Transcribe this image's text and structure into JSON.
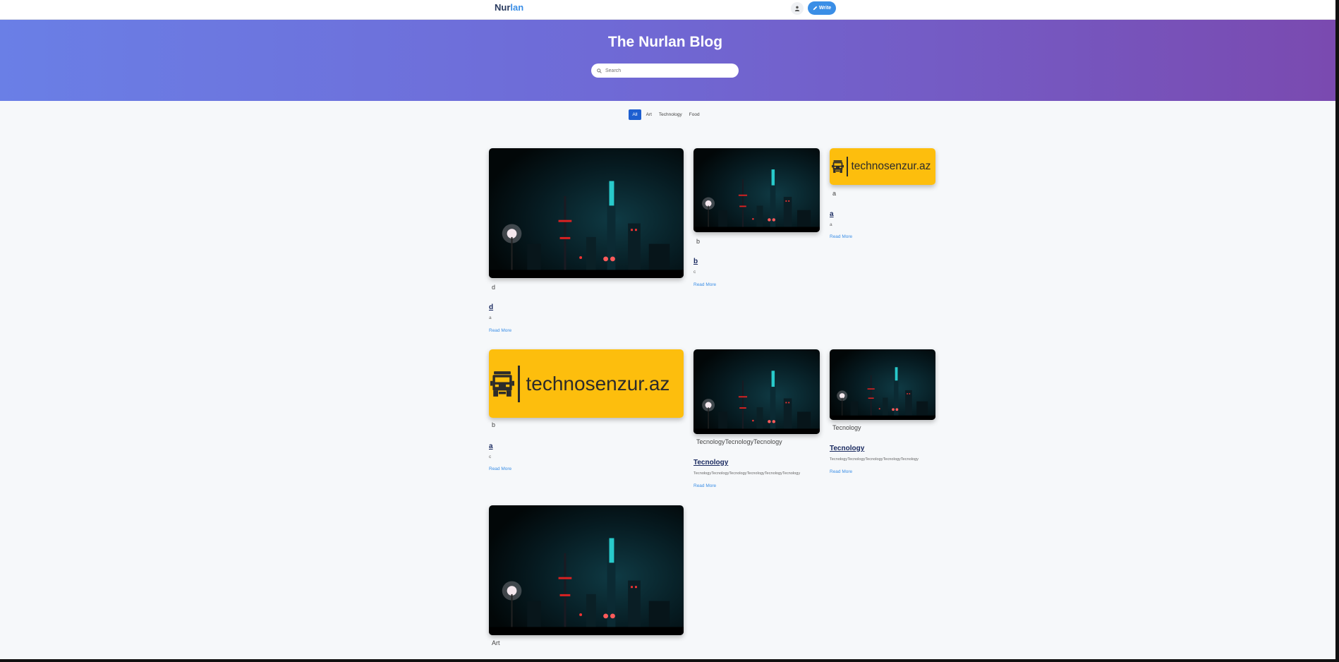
{
  "nav": {
    "brand_part1": "Nur",
    "brand_part2": "lan",
    "write_label": "Write"
  },
  "hero": {
    "title": "The Nurlan Blog",
    "search_placeholder": "Search"
  },
  "categories": [
    "All",
    "Art",
    "Technology",
    "Food"
  ],
  "logo_text": "technosenzur.az",
  "read_more": "Read More",
  "posts": [
    {
      "image": "city",
      "tag": "d",
      "title": "d",
      "excerpt": "a"
    },
    {
      "image": "city",
      "tag": "b",
      "title": "b",
      "excerpt": "c"
    },
    {
      "image": "logo",
      "tag": "a",
      "title": "a",
      "excerpt": "a"
    },
    {
      "image": "logo",
      "tag": "b",
      "title": "a",
      "excerpt": "c"
    },
    {
      "image": "city",
      "tag": "TecnologyTecnologyTecnology",
      "title": "Tecnology",
      "excerpt": "TecnologyTecnologyTecnologyTecnologyTecnologyTecnology"
    },
    {
      "image": "city",
      "tag": "Tecnology",
      "title": "Tecnology",
      "excerpt": "TecnologyTecnologyTecnologyTecnologyTecnology"
    },
    {
      "image": "city",
      "tag": "Art"
    }
  ],
  "colors": {
    "accent": "#3a8ee6",
    "active_category": "#1e5fd0",
    "hero_gradient_start": "#6a7fe6",
    "hero_gradient_end": "#7a4ab0",
    "logo_background": "#fdbe0d"
  },
  "icons": [
    "user-icon",
    "pencil-icon",
    "search-icon",
    "truck-icon"
  ]
}
